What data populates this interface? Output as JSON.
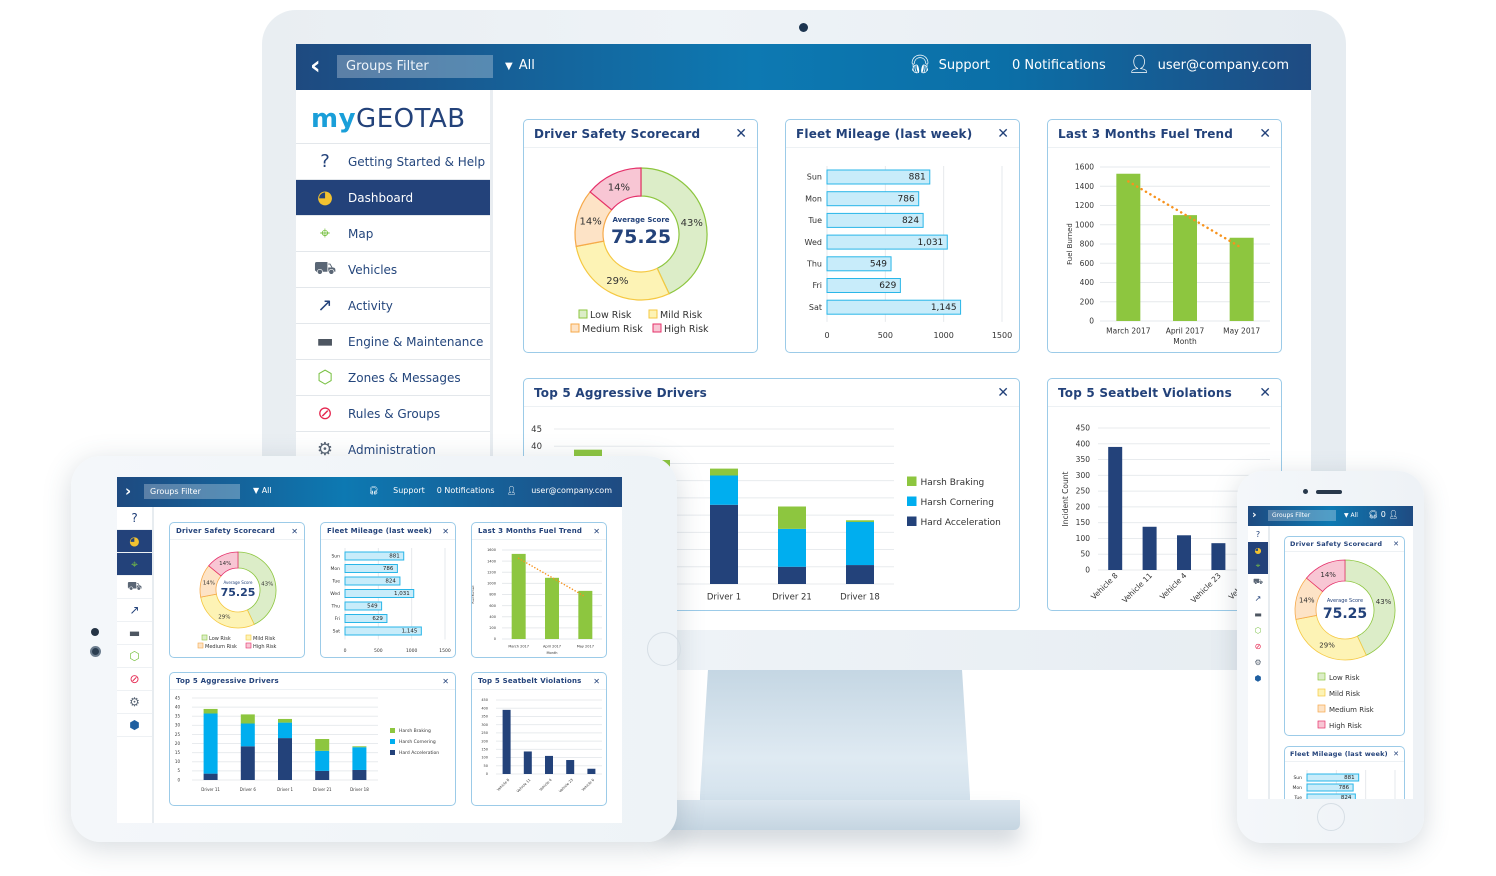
{
  "header": {
    "back_icon": "chevron-left-icon",
    "groups_filter": "Groups Filter",
    "filter_value": "All",
    "support": "Support",
    "notifications": "0 Notifications",
    "notifications_short": "0",
    "user": "user@company.com"
  },
  "logo": {
    "my": "my",
    "brand": "GEOTAB"
  },
  "sidebar": {
    "items": [
      {
        "label": "Getting Started & Help",
        "icon": "help-icon",
        "glyph": "?",
        "color": "#23427a"
      },
      {
        "label": "Dashboard",
        "icon": "dashboard-pie-icon",
        "glyph": "◕",
        "color": "#f2c230",
        "active": true
      },
      {
        "label": "Map",
        "icon": "map-icon",
        "glyph": "⌖",
        "color": "#79c143"
      },
      {
        "label": "Vehicles",
        "icon": "truck-icon",
        "glyph": "⛟",
        "color": "#5a6675"
      },
      {
        "label": "Activity",
        "icon": "activity-chart-icon",
        "glyph": "↗",
        "color": "#23427a"
      },
      {
        "label": "Engine & Maintenance",
        "icon": "engine-icon",
        "glyph": "▬",
        "color": "#4d5661"
      },
      {
        "label": "Zones & Messages",
        "icon": "zone-icon",
        "glyph": "⬡",
        "color": "#79c143"
      },
      {
        "label": "Rules & Groups",
        "icon": "prohibited-icon",
        "glyph": "⊘",
        "color": "#e5264f"
      },
      {
        "label": "Administration",
        "icon": "gear-icon",
        "glyph": "⚙",
        "color": "#5a6675"
      }
    ],
    "extra_icon": {
      "icon": "location-pin-icon",
      "glyph": "⬢",
      "color": "#1f5fa0"
    }
  },
  "colors": {
    "navy": "#23427a",
    "low_risk": "#dcedc8",
    "low_risk_stroke": "#8dc63f",
    "mild_risk": "#fdf3b5",
    "mild_risk_stroke": "#f5c842",
    "medium_risk": "#fde3c6",
    "medium_risk_stroke": "#f6a94a",
    "high_risk": "#f8c6d4",
    "high_risk_stroke": "#e5306a",
    "mileage_bar": "#c8ecfa",
    "mileage_stroke": "#29b6e8",
    "fuel_bar": "#8dc63f",
    "trend": "#f7931e",
    "harsh_braking": "#8dc63f",
    "harsh_cornering": "#00aeef",
    "hard_acceleration": "#23427a",
    "seatbelt_bar": "#23427a"
  },
  "widgets": {
    "scorecard": {
      "title": "Driver Safety Scorecard",
      "center_label": "Average Score",
      "center_value": "75.25",
      "close": "✕"
    },
    "mileage": {
      "title": "Fleet Mileage (last week)",
      "close": "✕"
    },
    "fuel": {
      "title": "Last 3 Months Fuel Trend",
      "close": "✕"
    },
    "aggressive": {
      "title": "Top 5 Aggressive Drivers",
      "close": "✕"
    },
    "seatbelt": {
      "title": "Top 5 Seatbelt Violations",
      "close": "✕"
    }
  },
  "chart_data": [
    {
      "id": "scorecard",
      "type": "pie",
      "title": "Driver Safety Scorecard",
      "categories": [
        "Low Risk",
        "Mild Risk",
        "Medium Risk",
        "High Risk"
      ],
      "values": [
        43,
        29,
        14,
        14
      ],
      "labels": [
        "43%",
        "29%",
        "14%",
        "14%"
      ],
      "center_label": "Average Score",
      "center_value": 75.25,
      "legend": [
        "Low Risk",
        "Mild Risk",
        "Medium Risk",
        "High Risk"
      ],
      "legend_position": "bottom"
    },
    {
      "id": "mileage",
      "type": "bar",
      "orientation": "horizontal",
      "title": "Fleet Mileage (last week)",
      "categories": [
        "Sun",
        "Mon",
        "Tue",
        "Wed",
        "Thu",
        "Fri",
        "Sat"
      ],
      "values": [
        881,
        786,
        824,
        1031,
        549,
        629,
        1145
      ],
      "value_labels": [
        "881",
        "786",
        "824",
        "1,031",
        "549",
        "629",
        "1,145"
      ],
      "xlim": [
        0,
        1500
      ],
      "xticks": [
        0,
        500,
        1000,
        1500
      ],
      "grid": true
    },
    {
      "id": "fuel",
      "type": "bar",
      "title": "Last 3 Months Fuel Trend",
      "categories": [
        "March 2017",
        "April 2017",
        "May 2017"
      ],
      "values": [
        1530,
        1100,
        865
      ],
      "trendline": {
        "start": 1450,
        "end": 760,
        "style": "dotted"
      },
      "xlabel": "Month",
      "ylabel": "Fuel Burned",
      "ylim": [
        0,
        1600
      ],
      "yticks": [
        0,
        200,
        400,
        600,
        800,
        1000,
        1200,
        1400,
        1600
      ],
      "grid": true
    },
    {
      "id": "aggressive",
      "type": "bar",
      "stacked": true,
      "title": "Top 5 Aggressive Drivers",
      "categories": [
        "Driver 11",
        "Driver 6",
        "Driver 1",
        "Driver 21",
        "Driver 18"
      ],
      "series": [
        {
          "name": "Hard Acceleration",
          "values": [
            3.5,
            18.5,
            23,
            5,
            5.5
          ]
        },
        {
          "name": "Harsh Cornering",
          "values": [
            33,
            12.5,
            8.5,
            11,
            12.5
          ]
        },
        {
          "name": "Harsh Braking",
          "values": [
            2.5,
            5,
            2,
            6.5,
            0.5
          ]
        }
      ],
      "legend": [
        "Harsh Braking",
        "Harsh Cornering",
        "Hard Acceleration"
      ],
      "legend_position": "right",
      "ylim": [
        0,
        45
      ],
      "yticks": [
        0,
        5,
        10,
        15,
        20,
        25,
        30,
        35,
        40,
        45
      ],
      "grid": true
    },
    {
      "id": "seatbelt",
      "type": "bar",
      "title": "Top 5 Seatbelt Violations",
      "categories": [
        "Vehicle 8",
        "Vehicle 11",
        "Vehicle 4",
        "Vehicle 23",
        "Vehicle 6"
      ],
      "values": [
        390,
        137,
        110,
        85,
        32
      ],
      "ylabel": "Incident Count",
      "ylim": [
        0,
        450
      ],
      "yticks": [
        0,
        50,
        100,
        150,
        200,
        250,
        300,
        350,
        400,
        450
      ],
      "grid": true
    }
  ]
}
